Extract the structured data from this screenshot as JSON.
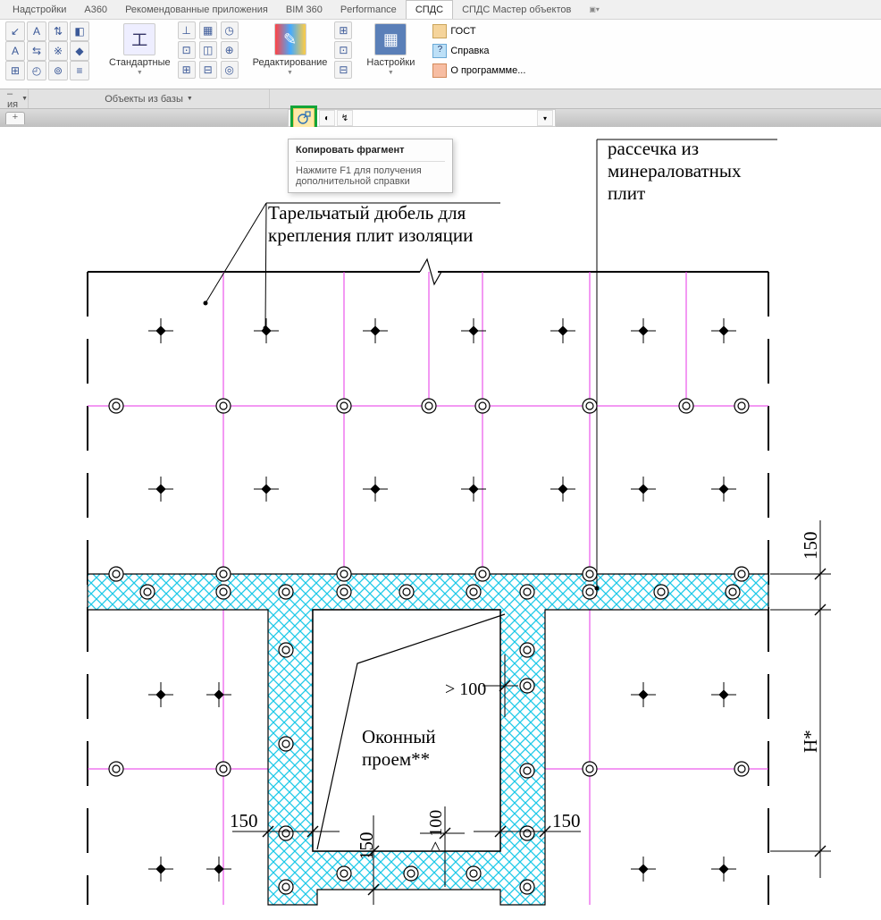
{
  "tabs": [
    "Надстройки",
    "A360",
    "Рекомендованные приложения",
    "BIM 360",
    "Performance",
    "СПДС",
    "СПДС Мастер объектов"
  ],
  "active_tab": "СПДС",
  "ribbon": {
    "group1": {
      "label": "Стандартные"
    },
    "group2": {
      "label": "Редактирование"
    },
    "group3": {
      "label": "Настройки"
    },
    "help": {
      "gost": "ГОСТ",
      "spravka": "Справка",
      "about": "О программме..."
    }
  },
  "panel_labels": {
    "p0": "–ия",
    "p1": "Объекты из базы"
  },
  "tooltip": {
    "title": "Копировать фрагмент",
    "help": "Нажмите F1 для получения дополнительной справки"
  },
  "drawing": {
    "note1_line1": "Тарельчатый дюбель для",
    "note1_line2": "крепления плит изоляции",
    "note2_line1": "рассечка из",
    "note2_line2": "минераловатных",
    "note2_line3": "плит",
    "window_l1": "Оконный",
    "window_l2": "проем**",
    "gt100a": "> 100",
    "gt100b": "> 100",
    "d150a": "150",
    "d150b": "150",
    "d150c": "150",
    "d150v": "150",
    "hstar": "H*"
  }
}
